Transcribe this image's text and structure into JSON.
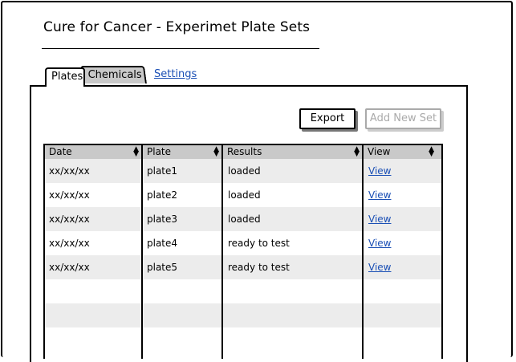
{
  "page": {
    "title": "Cure for Cancer - Experimet Plate Sets"
  },
  "tabs": [
    {
      "label": "Plates"
    },
    {
      "label": "Chemicals"
    },
    {
      "label": "Settings"
    }
  ],
  "toolbar": {
    "export_label": "Export",
    "add_label": "Add New Set"
  },
  "table": {
    "columns": [
      "Date",
      "Plate",
      "Results",
      "View"
    ],
    "rows": [
      {
        "date": "xx/xx/xx",
        "plate": "plate1",
        "results": "loaded",
        "view": "View"
      },
      {
        "date": "xx/xx/xx",
        "plate": "plate2",
        "results": "loaded",
        "view": "View"
      },
      {
        "date": "xx/xx/xx",
        "plate": "plate3",
        "results": "loaded",
        "view": "View"
      },
      {
        "date": "xx/xx/xx",
        "plate": "plate4",
        "results": "ready to test",
        "view": "View"
      },
      {
        "date": "xx/xx/xx",
        "plate": "plate5",
        "results": "ready to test",
        "view": "View"
      }
    ]
  },
  "colors": {
    "header_bg": "#c9c9c9",
    "alt_row_bg": "#ececec",
    "link": "#1a4fb5",
    "disabled": "#aaaaaa"
  }
}
